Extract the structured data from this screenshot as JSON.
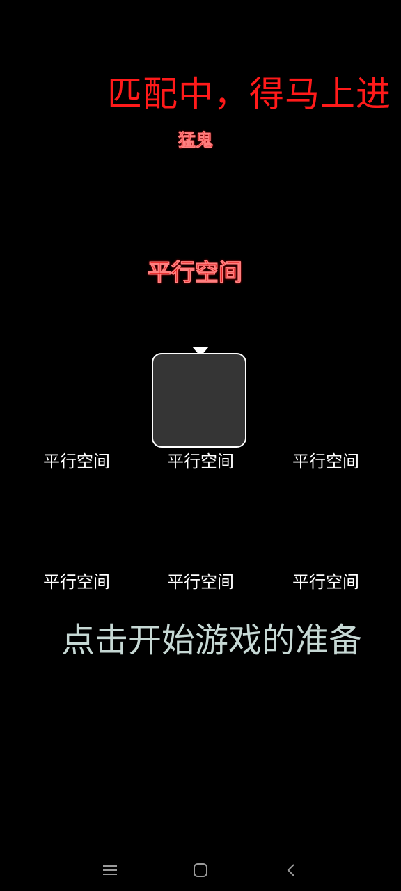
{
  "status": {
    "banner": "匹配中，得马上进",
    "role": "猛鬼"
  },
  "room": {
    "title": "平行空间"
  },
  "slots": [
    {
      "name": "平行空间"
    },
    {
      "name": "平行空间"
    },
    {
      "name": "平行空间"
    },
    {
      "name": "平行空间"
    },
    {
      "name": "平行空间"
    },
    {
      "name": "平行空间"
    }
  ],
  "actions": {
    "start_label": "点击开始游戏的准备"
  },
  "navbar": {
    "icons": [
      "menu-icon",
      "home-icon",
      "back-icon"
    ]
  },
  "colors": {
    "accent_red": "#ff1a1a",
    "start_text": "#c6d8d4",
    "avatar_fill": "#353535"
  }
}
